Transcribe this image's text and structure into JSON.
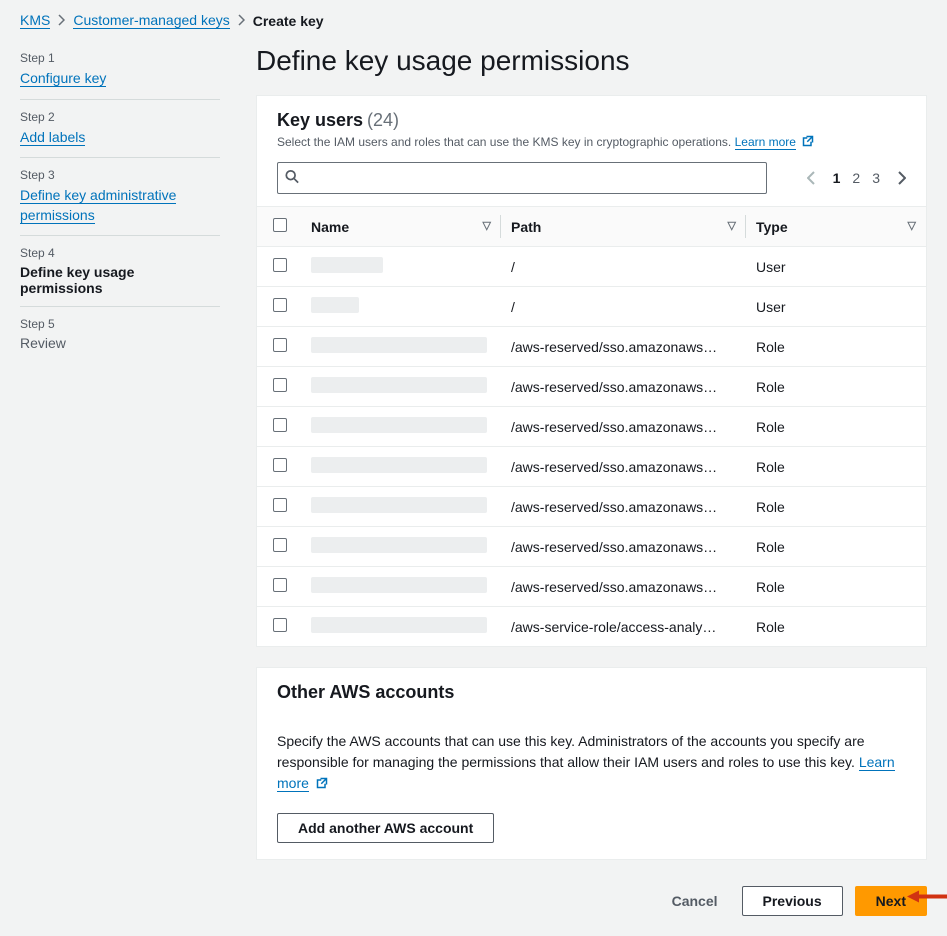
{
  "breadcrumb": {
    "items": [
      "KMS",
      "Customer-managed keys",
      "Create key"
    ]
  },
  "sidenav": {
    "steps": [
      {
        "label": "Step 1",
        "title": "Configure key",
        "state": "done"
      },
      {
        "label": "Step 2",
        "title": "Add labels",
        "state": "done"
      },
      {
        "label": "Step 3",
        "title": "Define key administrative permissions",
        "state": "done"
      },
      {
        "label": "Step 4",
        "title": "Define key usage permissions",
        "state": "current"
      },
      {
        "label": "Step 5",
        "title": "Review",
        "state": "future"
      }
    ]
  },
  "page": {
    "title": "Define key usage permissions"
  },
  "keyusers": {
    "title": "Key users",
    "count": "(24)",
    "subtitle": "Select the IAM users and roles that can use the KMS key in cryptographic operations.",
    "learn_more": "Learn more",
    "search_placeholder": "",
    "pages": [
      "1",
      "2",
      "3"
    ],
    "current_page": 0,
    "columns": {
      "name": "Name",
      "path": "Path",
      "type": "Type"
    },
    "rows": [
      {
        "path": "/",
        "type": "User",
        "skel_w": 72
      },
      {
        "path": "/",
        "type": "User",
        "skel_w": 48
      },
      {
        "path": "/aws-reserved/sso.amazonaws…",
        "type": "Role",
        "skel_w": 176
      },
      {
        "path": "/aws-reserved/sso.amazonaws…",
        "type": "Role",
        "skel_w": 176
      },
      {
        "path": "/aws-reserved/sso.amazonaws…",
        "type": "Role",
        "skel_w": 176
      },
      {
        "path": "/aws-reserved/sso.amazonaws…",
        "type": "Role",
        "skel_w": 176
      },
      {
        "path": "/aws-reserved/sso.amazonaws…",
        "type": "Role",
        "skel_w": 176
      },
      {
        "path": "/aws-reserved/sso.amazonaws…",
        "type": "Role",
        "skel_w": 176
      },
      {
        "path": "/aws-reserved/sso.amazonaws…",
        "type": "Role",
        "skel_w": 176
      },
      {
        "path": "/aws-service-role/access-analy…",
        "type": "Role",
        "skel_w": 176
      }
    ]
  },
  "otheraccounts": {
    "title": "Other AWS accounts",
    "desc": "Specify the AWS accounts that can use this key. Administrators of the accounts you specify are responsible for managing the permissions that allow their IAM users and roles to use this key.",
    "learn_more": "Learn more",
    "add_btn": "Add another AWS account"
  },
  "footer": {
    "cancel": "Cancel",
    "previous": "Previous",
    "next": "Next"
  }
}
